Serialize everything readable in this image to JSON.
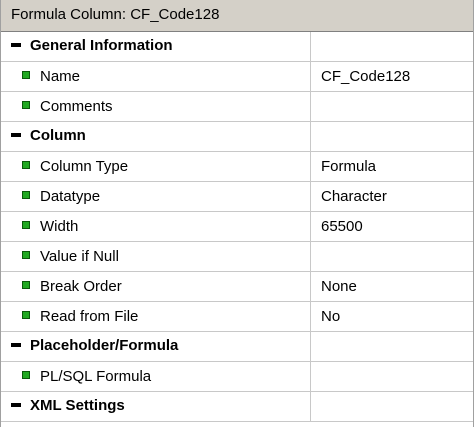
{
  "window": {
    "title": "Formula Column: CF_Code128"
  },
  "sections": [
    {
      "label": "General Information",
      "properties": [
        {
          "name": "Name",
          "value": "CF_Code128"
        },
        {
          "name": "Comments",
          "value": ""
        }
      ]
    },
    {
      "label": "Column",
      "properties": [
        {
          "name": "Column Type",
          "value": "Formula"
        },
        {
          "name": "Datatype",
          "value": "Character"
        },
        {
          "name": "Width",
          "value": "65500"
        },
        {
          "name": "Value if Null",
          "value": ""
        },
        {
          "name": "Break Order",
          "value": "None"
        },
        {
          "name": "Read from File",
          "value": "No"
        }
      ]
    },
    {
      "label": "Placeholder/Formula",
      "properties": [
        {
          "name": "PL/SQL Formula",
          "value": ""
        }
      ]
    },
    {
      "label": "XML Settings",
      "properties": []
    }
  ],
  "icons": {
    "section_toggle": "collapse-minus-icon",
    "property_marker": "green-square-icon"
  },
  "colors": {
    "titlebar_bg": "#d4d0c8",
    "property_marker": "#22aa22",
    "grid_line": "#c8c8c8"
  }
}
